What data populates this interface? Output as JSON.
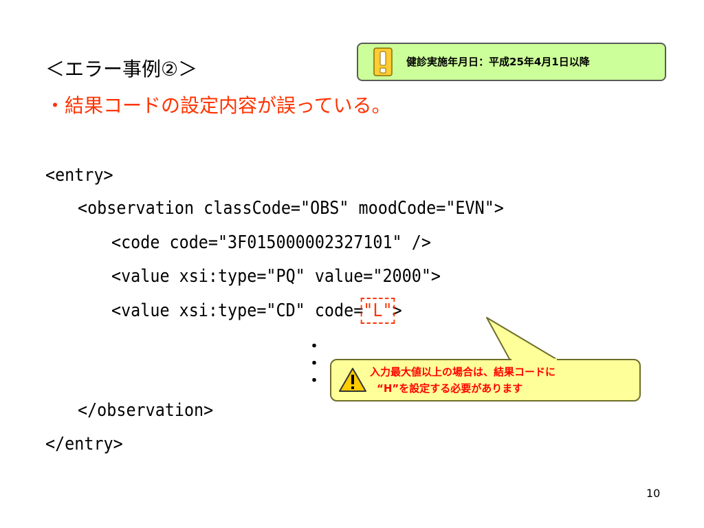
{
  "notice": {
    "text": "健診実施年月日：平成25年4月1日以降",
    "icon": "exclamation-icon",
    "background": "#ccff99"
  },
  "heading": "＜エラー事例②＞",
  "subheading": "・結果コードの設定内容が誤っている。",
  "code": {
    "line1": "<entry>",
    "line2": "<observation classCode=\"OBS\" moodCode=\"EVN\">",
    "line3": "<code code=\"3F015000002327101\" />",
    "line4": "<value xsi:type=\"PQ\" value=\"2000\">",
    "line5_prefix": "<value xsi:type=\"CD\" code=",
    "line5_error": "\"L\"",
    "line5_suffix": ">",
    "line6": "</observation>",
    "line7": "</entry>"
  },
  "ellipsis": [
    "・",
    "・",
    "・"
  ],
  "callout": {
    "line1": "入力最大値以上の場合は、結果コードに",
    "line2": "“H”を設定する必要があります",
    "icon": "warning-icon",
    "background": "#ffff99",
    "text_color": "#ff0000"
  },
  "page_number": "10"
}
